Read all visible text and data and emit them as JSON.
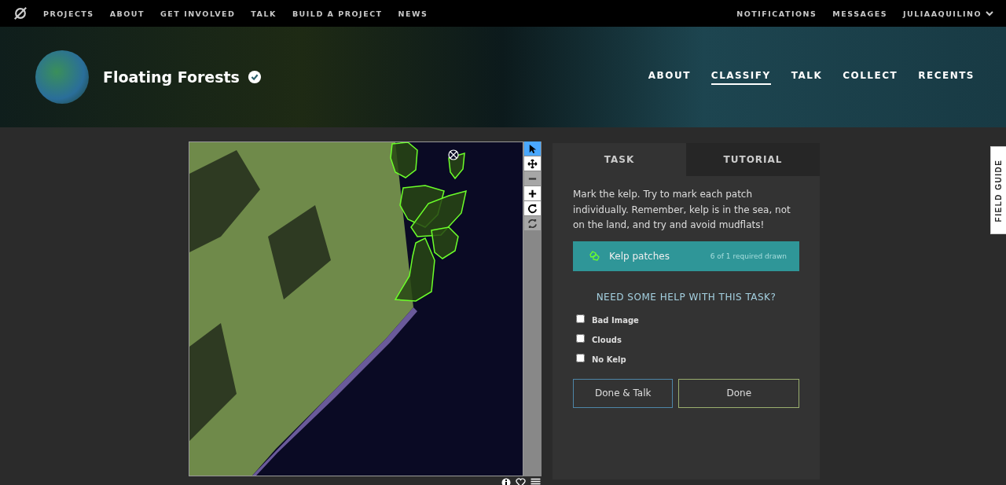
{
  "top_nav": {
    "links": [
      "PROJECTS",
      "ABOUT",
      "GET INVOLVED",
      "TALK",
      "BUILD A PROJECT",
      "NEWS"
    ],
    "right_links": [
      "NOTIFICATIONS",
      "MESSAGES"
    ],
    "user": "JULIAAQUILINO"
  },
  "project": {
    "title": "Floating Forests",
    "verified": true,
    "tabs": [
      {
        "label": "ABOUT",
        "selected": false
      },
      {
        "label": "CLASSIFY",
        "selected": true
      },
      {
        "label": "TALK",
        "selected": false
      },
      {
        "label": "COLLECT",
        "selected": false
      },
      {
        "label": "RECENTS",
        "selected": false
      }
    ]
  },
  "viewer": {
    "tools": [
      {
        "kind": "pointer",
        "selected": true,
        "disabled": false
      },
      {
        "kind": "move",
        "selected": false,
        "disabled": false
      },
      {
        "kind": "zoom-out",
        "selected": false,
        "disabled": true
      },
      {
        "kind": "zoom-in",
        "selected": false,
        "disabled": false
      },
      {
        "kind": "rotate",
        "selected": false,
        "disabled": false
      },
      {
        "kind": "reset",
        "selected": false,
        "disabled": true
      }
    ]
  },
  "task_panel": {
    "tabs": [
      {
        "label": "TASK",
        "selected": true
      },
      {
        "label": "TUTORIAL",
        "selected": false
      }
    ],
    "instruction": "Mark the kelp. Try to mark each patch individually. Remember, kelp is in the sea, not on the land, and try and avoid mudflats!",
    "tool": {
      "label": "Kelp patches",
      "count": "6 of 1 required drawn"
    },
    "help_heading": "NEED SOME HELP WITH THIS TASK?",
    "options": [
      {
        "label": "Bad Image",
        "checked": false
      },
      {
        "label": "Clouds",
        "checked": false
      },
      {
        "label": "No Kelp",
        "checked": false
      }
    ],
    "buttons": [
      "Done & Talk",
      "Done"
    ]
  },
  "field_guide": "FIELD GUIDE"
}
